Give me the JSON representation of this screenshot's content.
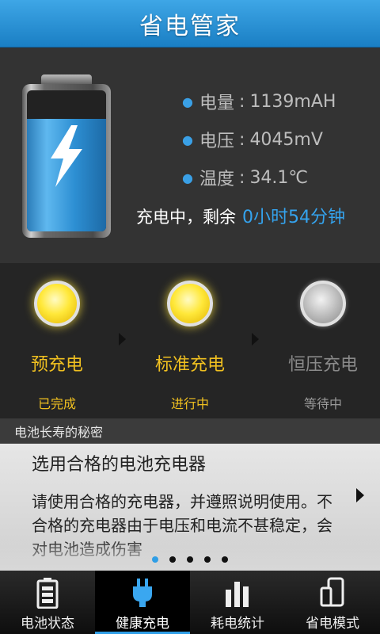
{
  "header": {
    "title": "省电管家"
  },
  "battery": {
    "level_fraction": 0.8,
    "stats": [
      {
        "label": "电量",
        "sep": ":",
        "value": "1139mAH"
      },
      {
        "label": "电压",
        "sep": ":",
        "value": "4045mV"
      },
      {
        "label": "温度",
        "sep": ":",
        "value": "34.1℃"
      }
    ],
    "charging_text": "充电中，剩余",
    "remaining": "0小时54分钟"
  },
  "stages": [
    {
      "name": "预充电",
      "status": "已完成",
      "lamp": "on"
    },
    {
      "name": "标准充电",
      "status": "进行中",
      "lamp": "on"
    },
    {
      "name": "恒压充电",
      "status": "等待中",
      "lamp": "off"
    }
  ],
  "tips": {
    "header": "电池长寿的秘密",
    "title": "选用合格的电池充电器",
    "text": "请使用合格的充电器，并遵照说明使用。不合格的充电器由于电压和电流不甚稳定，会对电池造成伤害",
    "page_count": 5,
    "current_page": 1
  },
  "nav": [
    {
      "label": "电池状态",
      "icon": "battery-status-icon"
    },
    {
      "label": "健康充电",
      "icon": "plug-icon",
      "active": true
    },
    {
      "label": "耗电统计",
      "icon": "bar-chart-icon"
    },
    {
      "label": "省电模式",
      "icon": "phone-icon"
    }
  ],
  "colors": {
    "accent": "#2f9ee6",
    "stage_active": "#f0c020"
  }
}
